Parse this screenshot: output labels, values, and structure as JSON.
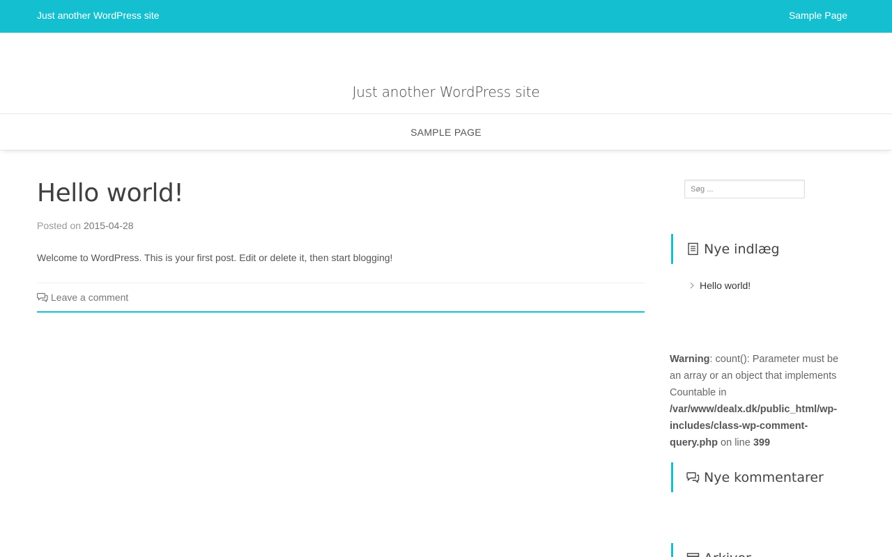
{
  "topbar": {
    "site_link": "Just another WordPress site",
    "menu_item": "Sample Page",
    "accent": "#14bfcf"
  },
  "header": {
    "site_title": "Just another WordPress site"
  },
  "nav": {
    "item": "SAMPLE PAGE"
  },
  "post": {
    "title": "Hello world!",
    "meta_prefix": "Posted on",
    "date": "2015-04-28",
    "content": "Welcome to WordPress. This is your first post. Edit or delete it, then start blogging!",
    "comment_link": "Leave a comment",
    "comment_icon": "comments-icon"
  },
  "sidebar": {
    "search_placeholder": "Søg ...",
    "recent_posts_title": "Nye indlæg",
    "recent_posts_icon": "document-icon",
    "recent_posts": [
      "Hello world!"
    ],
    "warning": {
      "label": "Warning",
      "message": ": count(): Parameter must be an array or an object that implements Countable in ",
      "path": "/var/www/dealx.dk/public_html/wp-includes/class-wp-comment-query.php",
      "line_text": " on line ",
      "line": "399"
    },
    "recent_comments_title": "Nye kommentarer",
    "recent_comments_icon": "comments-icon",
    "archives_title": "Arkiver",
    "archives_icon": "archive-icon"
  }
}
